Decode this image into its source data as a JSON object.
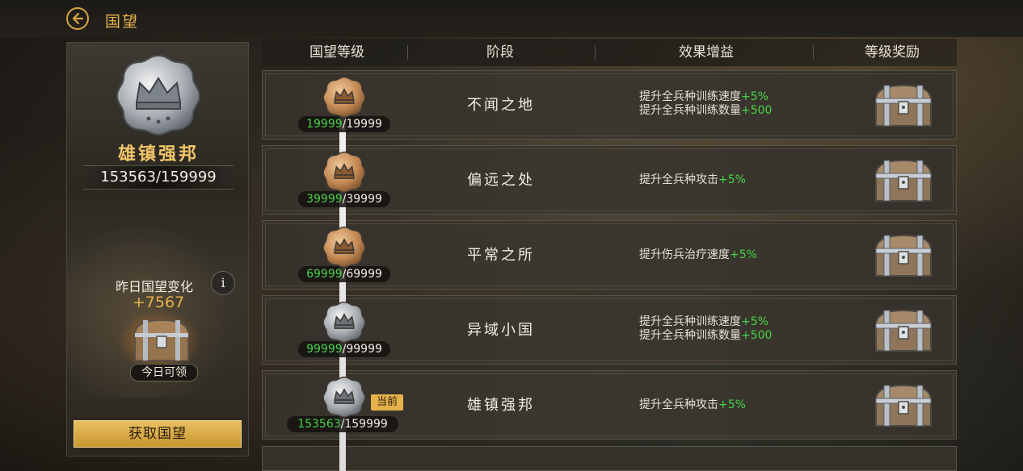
{
  "header": {
    "title": "国望"
  },
  "left_panel": {
    "rank_name": "雄镇强邦",
    "progress": "153563/159999",
    "yesterday_label": "昨日国望变化",
    "info_symbol": "i",
    "yesterday_value": "+7567",
    "claim_label": "今日可领",
    "get_button": "获取国望"
  },
  "table": {
    "columns": [
      "国望等级",
      "阶段",
      "效果增益",
      "等级奖励"
    ],
    "current_tag": "当前",
    "rows": [
      {
        "current": "19999",
        "total": "/19999",
        "stage": "不闻之地",
        "medal": "bronze",
        "effects": [
          {
            "text": "提升全兵种训练速度",
            "plus": "+5%"
          },
          {
            "text": "提升全兵种训练数量",
            "plus": "+500"
          }
        ]
      },
      {
        "current": "39999",
        "total": "/39999",
        "stage": "偏远之处",
        "medal": "bronze",
        "effects": [
          {
            "text": "提升全兵种攻击",
            "plus": "+5%"
          }
        ]
      },
      {
        "current": "69999",
        "total": "/69999",
        "stage": "平常之所",
        "medal": "bronze",
        "effects": [
          {
            "text": "提升伤兵治疗速度",
            "plus": "+5%"
          }
        ]
      },
      {
        "current": "99999",
        "total": "/99999",
        "stage": "异域小国",
        "medal": "silver",
        "effects": [
          {
            "text": "提升全兵种训练速度",
            "plus": "+5%"
          },
          {
            "text": "提升全兵种训练数量",
            "plus": "+500"
          }
        ]
      },
      {
        "current": "153563",
        "total": "/159999",
        "stage": "雄镇强邦",
        "medal": "silver",
        "effects": [
          {
            "text": "提升全兵种攻击",
            "plus": "+5%"
          }
        ]
      }
    ]
  },
  "icons": {
    "back": "back-arrow-icon",
    "medal": "crown-medal-icon",
    "chest": "treasure-chest-icon",
    "info": "info-icon"
  },
  "colors": {
    "accent": "#e6b24c",
    "progress_green": "#47d447"
  }
}
